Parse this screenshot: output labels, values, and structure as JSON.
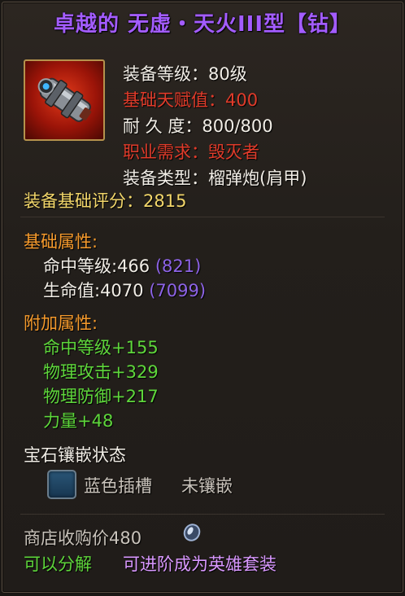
{
  "title": "卓越的 无虚・天火III型【钻】",
  "stats": {
    "equip_level": "装备等级：80级",
    "base_talent": "基础天赋值：400",
    "durability": "耐 久 度：800/800",
    "class_req": "职业需求：毁灭者",
    "equip_type": "装备类型：榴弹炮(肩甲)"
  },
  "score": "装备基础评分：2815",
  "base_attrs": {
    "heading": "基础属性:",
    "items": [
      {
        "label": "命中等级:466",
        "extra": "(821)"
      },
      {
        "label": "生命值:4070",
        "extra": "(7099)"
      }
    ]
  },
  "extra_attrs": {
    "heading": "附加属性:",
    "items": [
      "命中等级+155",
      "物理攻击+329",
      "物理防御+217",
      "力量+48"
    ]
  },
  "gem": {
    "heading": "宝石镶嵌状态",
    "slot_label": "蓝色插槽",
    "slot_status": "未镶嵌"
  },
  "footer": {
    "sell_price": "商店收购价480",
    "decomposable": "可以分解",
    "upgrade": "可进阶成为英雄套装"
  },
  "icons": {
    "item": "shoulder-cannon-icon",
    "currency": "coin-icon",
    "gem_slot": "blue-gem-slot-icon"
  },
  "colors": {
    "title": "#a35cff",
    "red": "#e03b2a",
    "yellow": "#f2d66a",
    "orange": "#f59a2c",
    "green": "#5ed63b",
    "purple": "#8d63e6"
  }
}
